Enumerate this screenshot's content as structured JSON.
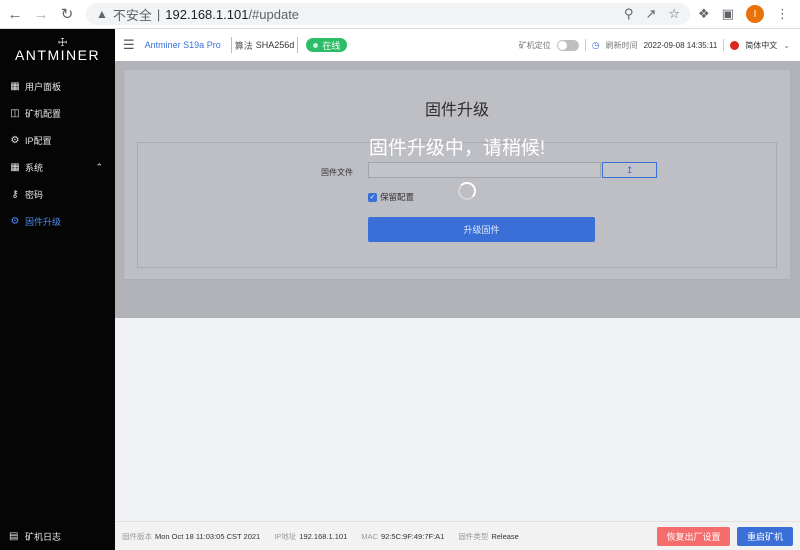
{
  "browser": {
    "insecure_label": "不安全",
    "separator": "|",
    "url_host": "192.168.1.101",
    "url_path": "/#update",
    "profile_initial": "I"
  },
  "sidebar": {
    "logo": "ANTMINER",
    "items": [
      {
        "label": "用户面板",
        "icon": "dashboard-icon"
      },
      {
        "label": "矿机配置",
        "icon": "miner-config-icon"
      },
      {
        "label": "IP配置",
        "icon": "ip-config-icon"
      },
      {
        "label": "系统",
        "icon": "system-icon"
      },
      {
        "label": "密码",
        "icon": "key-icon"
      },
      {
        "label": "固件升级",
        "icon": "firmware-icon"
      }
    ],
    "bottom_label": "矿机日志"
  },
  "header": {
    "model": "Antminer S19a Pro",
    "algo_label": "算法",
    "algo_value": "SHA256d",
    "status": "在线",
    "locate_label": "矿机定位",
    "refresh_label": "刷新时间",
    "refresh_time": "2022-09-08 14:35:11",
    "language": "简体中文"
  },
  "main": {
    "title": "固件升级",
    "wait_message": "固件升级中，请稍候!",
    "file_label": "固件文件",
    "keep_config_label": "保留配置",
    "upgrade_button": "升级固件"
  },
  "footer": {
    "firmware_label": "固件版本",
    "firmware_value": "Mon Oct 18 11:03:05 CST 2021",
    "ip_label": "IP地址",
    "ip_value": "192.168.1.101",
    "mac_label": "MAC",
    "mac_value": "92:5C:9F:49:7F:A1",
    "fw_type_label": "固件类型",
    "fw_type_value": "Release",
    "reset_button": "恢复出厂设置",
    "reboot_button": "重启矿机"
  },
  "colors": {
    "accent": "#3a6fd8",
    "online": "#2dbd67",
    "danger": "#f56c6c",
    "sidebar_bg": "#050505"
  }
}
